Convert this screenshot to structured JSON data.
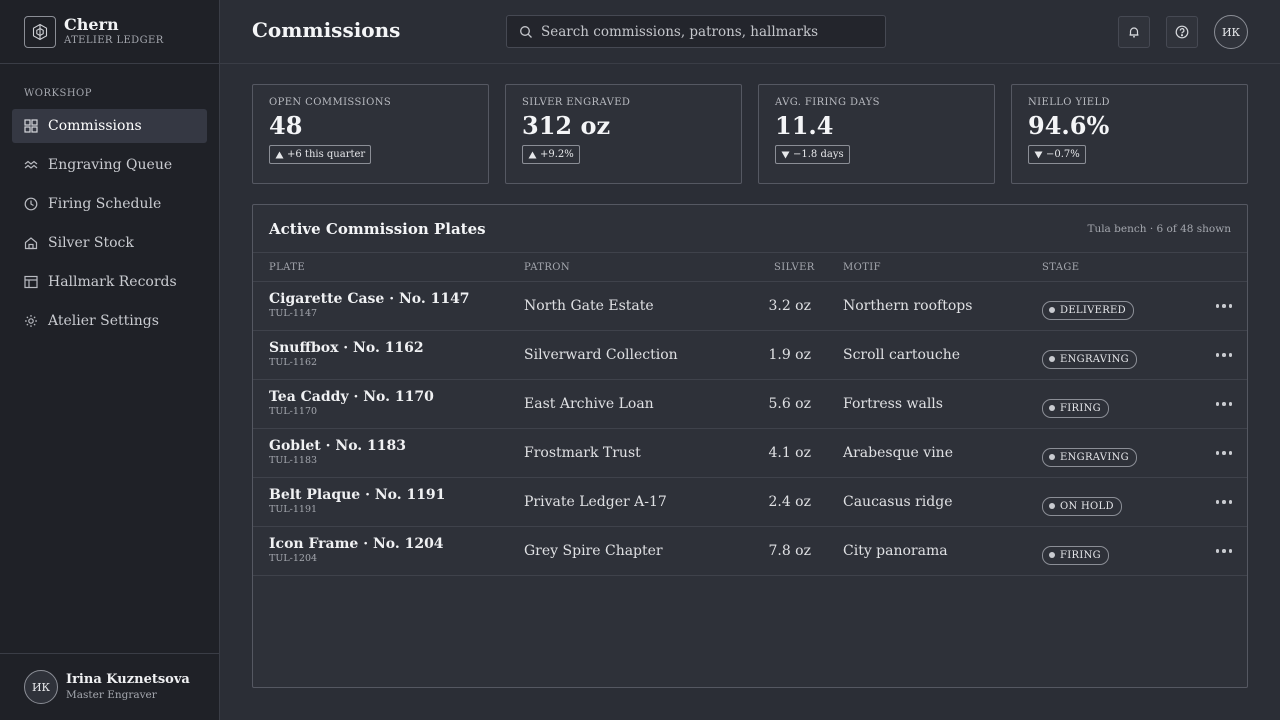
{
  "brand": {
    "name": "Chern",
    "subtitle": "ATELIER LEDGER"
  },
  "sidebar": {
    "section": "WORKSHOP",
    "items": [
      {
        "label": "Commissions",
        "icon": "grid-icon",
        "active": true
      },
      {
        "label": "Engraving Queue",
        "icon": "wave-icon",
        "active": false
      },
      {
        "label": "Firing Schedule",
        "icon": "clock-icon",
        "active": false
      },
      {
        "label": "Silver Stock",
        "icon": "house-icon",
        "active": false
      },
      {
        "label": "Hallmark Records",
        "icon": "table-icon",
        "active": false
      },
      {
        "label": "Atelier Settings",
        "icon": "gear-icon",
        "active": false
      }
    ]
  },
  "user": {
    "initials": "ИК",
    "name": "Irina Kuznetsova",
    "role": "Master Engraver"
  },
  "header": {
    "title": "Commissions",
    "search_placeholder": "Search commissions, patrons, hallmarks",
    "avatar_initials": "ИК"
  },
  "kpis": [
    {
      "label": "OPEN COMMISSIONS",
      "value": "48",
      "delta": "+6 this quarter",
      "direction": "up"
    },
    {
      "label": "SILVER ENGRAVED",
      "value": "312 oz",
      "delta": "+9.2%",
      "direction": "up"
    },
    {
      "label": "AVG. FIRING DAYS",
      "value": "11.4",
      "delta": "−1.8 days",
      "direction": "down"
    },
    {
      "label": "NIELLO YIELD",
      "value": "94.6%",
      "delta": "−0.7%",
      "direction": "down"
    }
  ],
  "table": {
    "title": "Active Commission Plates",
    "meta": "Tula bench · 6 of 48 shown",
    "columns": {
      "plate": "PLATE",
      "patron": "PATRON",
      "silver": "SILVER",
      "motif": "MOTIF",
      "stage": "STAGE"
    },
    "rows": [
      {
        "plate": "Cigarette Case · No. 1147",
        "code": "TUL-1147",
        "patron": "North Gate Estate",
        "silver": "3.2 oz",
        "motif": "Northern rooftops",
        "stage": "DELIVERED"
      },
      {
        "plate": "Snuffbox · No. 1162",
        "code": "TUL-1162",
        "patron": "Silverward Collection",
        "silver": "1.9 oz",
        "motif": "Scroll cartouche",
        "stage": "ENGRAVING"
      },
      {
        "plate": "Tea Caddy · No. 1170",
        "code": "TUL-1170",
        "patron": "East Archive Loan",
        "silver": "5.6 oz",
        "motif": "Fortress walls",
        "stage": "FIRING"
      },
      {
        "plate": "Goblet · No. 1183",
        "code": "TUL-1183",
        "patron": "Frostmark Trust",
        "silver": "4.1 oz",
        "motif": "Arabesque vine",
        "stage": "ENGRAVING"
      },
      {
        "plate": "Belt Plaque · No. 1191",
        "code": "TUL-1191",
        "patron": "Private Ledger A-17",
        "silver": "2.4 oz",
        "motif": "Caucasus ridge",
        "stage": "ON HOLD"
      },
      {
        "plate": "Icon Frame · No. 1204",
        "code": "TUL-1204",
        "patron": "Grey Spire Chapter",
        "silver": "7.8 oz",
        "motif": "City panorama",
        "stage": "FIRING"
      }
    ]
  }
}
